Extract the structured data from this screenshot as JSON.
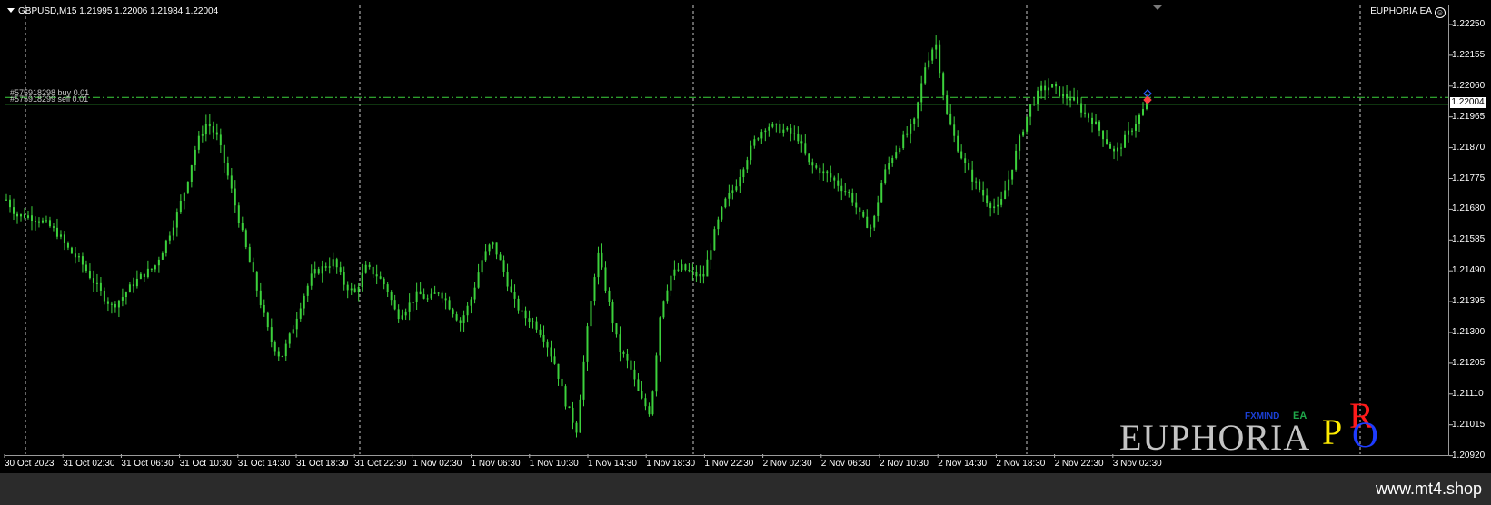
{
  "chart_header": {
    "symbol_label": "GBPUSD,M15  1.21995 1.22006 1.21984 1.22004",
    "expert_label": "EUPHORIA EA",
    "smiley": "☺"
  },
  "orders": [
    {
      "label": "#575918298 buy 0.01"
    },
    {
      "label": "#575918299 sell 0.01"
    }
  ],
  "current_price": "1.22004",
  "price_axis": [
    "1.22250",
    "1.22155",
    "1.22060",
    "1.21965",
    "1.21870",
    "1.21775",
    "1.21680",
    "1.21585",
    "1.21490",
    "1.21395",
    "1.21300",
    "1.21205",
    "1.21110",
    "1.21015",
    "1.20920"
  ],
  "time_axis": [
    "30 Oct 2023",
    "31 Oct 02:30",
    "31 Oct 06:30",
    "31 Oct 10:30",
    "31 Oct 14:30",
    "31 Oct 18:30",
    "31 Oct 22:30",
    "1 Nov 02:30",
    "1 Nov 06:30",
    "1 Nov 10:30",
    "1 Nov 14:30",
    "1 Nov 18:30",
    "1 Nov 22:30",
    "2 Nov 02:30",
    "2 Nov 06:30",
    "2 Nov 10:30",
    "2 Nov 14:30",
    "2 Nov 18:30",
    "2 Nov 22:30",
    "3 Nov 02:30"
  ],
  "logo": {
    "main": "EUPHORIA",
    "fxmind": "FXMIND",
    "ea": "EA",
    "p": "P",
    "r": "R",
    "o": "O"
  },
  "watermark": "www.mt4.shop",
  "colors": {
    "background": "#000000",
    "candles": "#3cd13c",
    "grid": "#c8c8c8",
    "order_line": "#3cd13c",
    "axis_text": "#ffffff"
  },
  "chart_data": {
    "type": "candlestick",
    "symbol": "GBPUSD",
    "timeframe": "M15",
    "ylim": [
      1.2088,
      1.2236
    ],
    "yticks": [
      1.2225,
      1.22155,
      1.2206,
      1.21965,
      1.2187,
      1.21775,
      1.2168,
      1.21585,
      1.2149,
      1.21395,
      1.213,
      1.21205,
      1.2111,
      1.21015,
      1.2092
    ],
    "order_levels": [
      1.22025,
      1.22004
    ],
    "bars_total": 315,
    "close_path": [
      [
        0,
        1.2171
      ],
      [
        6,
        1.2166
      ],
      [
        12,
        1.2166
      ],
      [
        18,
        1.2165
      ],
      [
        24,
        1.2163
      ],
      [
        30,
        1.216
      ],
      [
        36,
        1.2155
      ],
      [
        42,
        1.2152
      ],
      [
        48,
        1.2147
      ],
      [
        54,
        1.2142
      ],
      [
        60,
        1.2138
      ],
      [
        66,
        1.2141
      ],
      [
        72,
        1.2145
      ],
      [
        78,
        1.2148
      ],
      [
        84,
        1.215
      ],
      [
        90,
        1.2157
      ],
      [
        96,
        1.2165
      ],
      [
        102,
        1.2175
      ],
      [
        108,
        1.2188
      ],
      [
        114,
        1.2195
      ],
      [
        120,
        1.219
      ],
      [
        126,
        1.2178
      ],
      [
        132,
        1.2165
      ],
      [
        138,
        1.2152
      ],
      [
        144,
        1.214
      ],
      [
        150,
        1.2128
      ],
      [
        156,
        1.2122
      ],
      [
        162,
        1.213
      ],
      [
        168,
        1.214
      ],
      [
        174,
        1.2148
      ],
      [
        180,
        1.215
      ],
      [
        186,
        1.2152
      ],
      [
        192,
        1.2145
      ],
      [
        198,
        1.2142
      ],
      [
        204,
        1.215
      ],
      [
        210,
        1.2148
      ],
      [
        216,
        1.2144
      ],
      [
        222,
        1.2135
      ],
      [
        228,
        1.2138
      ],
      [
        234,
        1.2142
      ],
      [
        240,
        1.214
      ],
      [
        246,
        1.2143
      ],
      [
        252,
        1.2138
      ],
      [
        258,
        1.2133
      ],
      [
        264,
        1.214
      ],
      [
        270,
        1.2152
      ],
      [
        276,
        1.2158
      ],
      [
        282,
        1.215
      ],
      [
        288,
        1.214
      ],
      [
        294,
        1.2135
      ],
      [
        300,
        1.2133
      ],
      [
        306,
        1.2128
      ],
      [
        312,
        1.212
      ],
      [
        318,
        1.2108
      ],
      [
        324,
        1.21
      ],
      [
        330,
        1.213
      ],
      [
        336,
        1.2155
      ],
      [
        342,
        1.214
      ],
      [
        348,
        1.2125
      ],
      [
        354,
        1.212
      ],
      [
        360,
        1.211
      ],
      [
        366,
        1.2105
      ],
      [
        372,
        1.2138
      ],
      [
        378,
        1.2148
      ],
      [
        384,
        1.215
      ],
      [
        390,
        1.2148
      ],
      [
        396,
        1.2147
      ],
      [
        402,
        1.216
      ],
      [
        408,
        1.217
      ],
      [
        414,
        1.2175
      ],
      [
        420,
        1.2183
      ],
      [
        426,
        1.219
      ],
      [
        432,
        1.2194
      ],
      [
        438,
        1.2193
      ],
      [
        444,
        1.2192
      ],
      [
        450,
        1.219
      ],
      [
        456,
        1.2182
      ],
      [
        462,
        1.218
      ],
      [
        468,
        1.2178
      ],
      [
        474,
        1.2175
      ],
      [
        480,
        1.2172
      ],
      [
        486,
        1.2165
      ],
      [
        492,
        1.2162
      ],
      [
        498,
        1.2178
      ],
      [
        504,
        1.2185
      ],
      [
        510,
        1.219
      ],
      [
        516,
        1.2195
      ],
      [
        522,
        1.2212
      ],
      [
        528,
        1.222
      ],
      [
        534,
        1.2198
      ],
      [
        540,
        1.2188
      ],
      [
        546,
        1.218
      ],
      [
        552,
        1.2175
      ],
      [
        558,
        1.217
      ],
      [
        564,
        1.2168
      ],
      [
        570,
        1.2178
      ],
      [
        576,
        1.219
      ],
      [
        582,
        1.22
      ],
      [
        588,
        1.2205
      ],
      [
        594,
        1.2206
      ],
      [
        600,
        1.2203
      ],
      [
        606,
        1.2202
      ],
      [
        612,
        1.2198
      ],
      [
        618,
        1.2195
      ],
      [
        624,
        1.219
      ],
      [
        630,
        1.2185
      ],
      [
        636,
        1.219
      ],
      [
        642,
        1.2195
      ],
      [
        648,
        1.22004
      ]
    ]
  }
}
